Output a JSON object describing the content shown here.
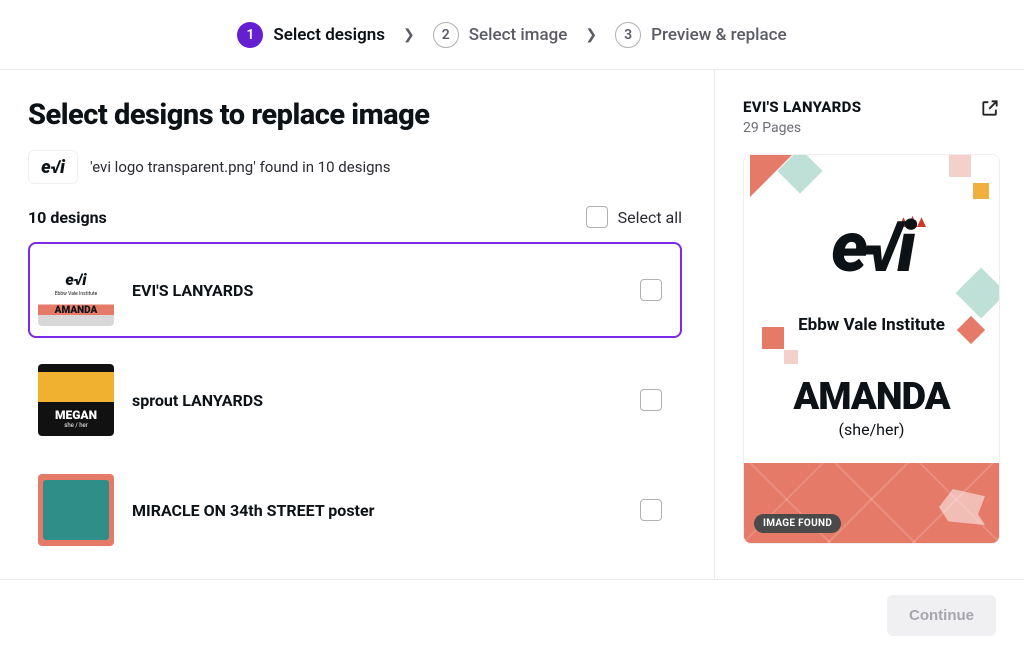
{
  "stepper": {
    "steps": [
      {
        "num": "1",
        "label": "Select designs",
        "active": true
      },
      {
        "num": "2",
        "label": "Select image",
        "active": false
      },
      {
        "num": "3",
        "label": "Preview & replace",
        "active": false
      }
    ]
  },
  "page_title": "Select designs to replace image",
  "found": {
    "thumb_text": "e√i",
    "text": "'evi logo transparent.png' found in 10 designs"
  },
  "list": {
    "count_label": "10 designs",
    "select_all_label": "Select all",
    "items": [
      {
        "title": "EVI'S LANYARDS",
        "selected": true,
        "thumb_class": "t1"
      },
      {
        "title": "sprout LANYARDS",
        "selected": false,
        "thumb_class": "t2"
      },
      {
        "title": "MIRACLE ON 34th STREET poster",
        "selected": false,
        "thumb_class": "t3"
      },
      {
        "title": "",
        "selected": false,
        "thumb_class": "t4"
      }
    ]
  },
  "preview": {
    "title": "EVI'S LANYARDS",
    "pages": "29 Pages",
    "logo": "e√i",
    "institute": "Ebbw Vale Institute",
    "name": "AMANDA",
    "pronouns": "(she/her)",
    "badge": "IMAGE FOUND"
  },
  "thumb1": {
    "logo": "e√i",
    "sub": "Ebbw Vale Institute",
    "name": "AMANDA"
  },
  "thumb2": {
    "name": "MEGAN",
    "sub": "she / her"
  },
  "footer": {
    "continue": "Continue"
  }
}
